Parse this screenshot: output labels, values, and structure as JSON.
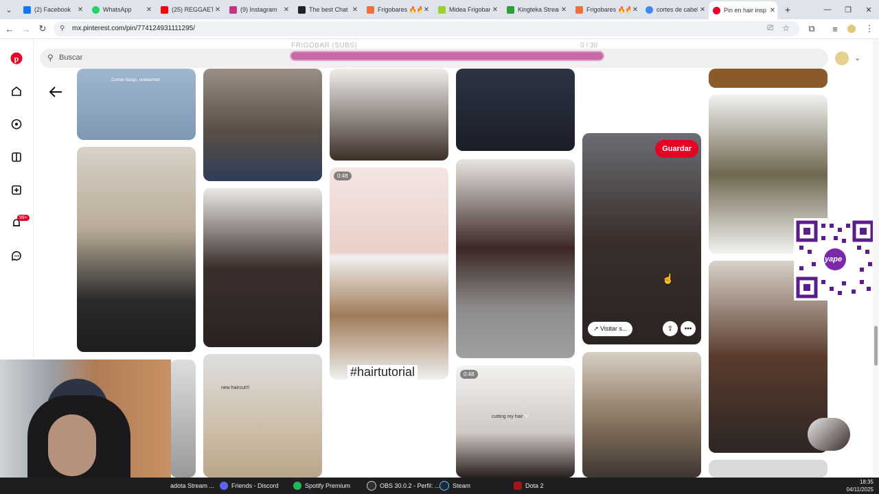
{
  "browser": {
    "tabs": [
      {
        "title": "(2) Facebook",
        "color": "#1877f2"
      },
      {
        "title": "WhatsApp",
        "color": "#25d366"
      },
      {
        "title": "(25) REGGAETON",
        "color": "#ff0000"
      },
      {
        "title": "(9) Instagram",
        "color": "#c13584"
      },
      {
        "title": "The best Chat",
        "color": "#222222"
      },
      {
        "title": "Frigobares 🔥🔥",
        "color": "#f0703a"
      },
      {
        "title": "Midea Frigobar",
        "color": "#9bd034"
      },
      {
        "title": "Kingteka Stream",
        "color": "#2e9d3a"
      },
      {
        "title": "Frigobares 🔥🔥",
        "color": "#f0703a"
      },
      {
        "title": "cortes de cabello",
        "color": "#4285f4"
      },
      {
        "title": "Pin en hair insp",
        "color": "#e60023"
      }
    ],
    "new_tab_label": "+",
    "url_prefix": "⚲",
    "url": "mx.pinterest.com/pin/774124931111295/"
  },
  "pinterest": {
    "search_placeholder": "Buscar",
    "save_label": "Guardar",
    "visit_label": "Visitar s...",
    "notification_count": "99+",
    "brand_color": "#e60023"
  },
  "overlay": {
    "label": "FRIGOBAR (SUBS)",
    "count": "0 / 30",
    "progress": 0
  },
  "pins": {
    "badge_1": "0:48",
    "badge_2": "0:48",
    "hairtutorial_text": "#hairtutorial",
    "caption_1": "Curtain bangs, unattached",
    "caption_2": "new haircut!!!",
    "caption_3": "cutting my hair 🤍"
  },
  "taskbar": {
    "items": [
      {
        "label": "adota Stream ..."
      },
      {
        "label": "Friends - Discord"
      },
      {
        "label": "Spotify Premium"
      },
      {
        "label": "OBS 30.0.2 - Perfil: ..."
      },
      {
        "label": "Steam"
      },
      {
        "label": "Dota 2"
      }
    ],
    "time": "18:35",
    "date": "04/11/2025"
  },
  "qr": {
    "label": "yape"
  }
}
